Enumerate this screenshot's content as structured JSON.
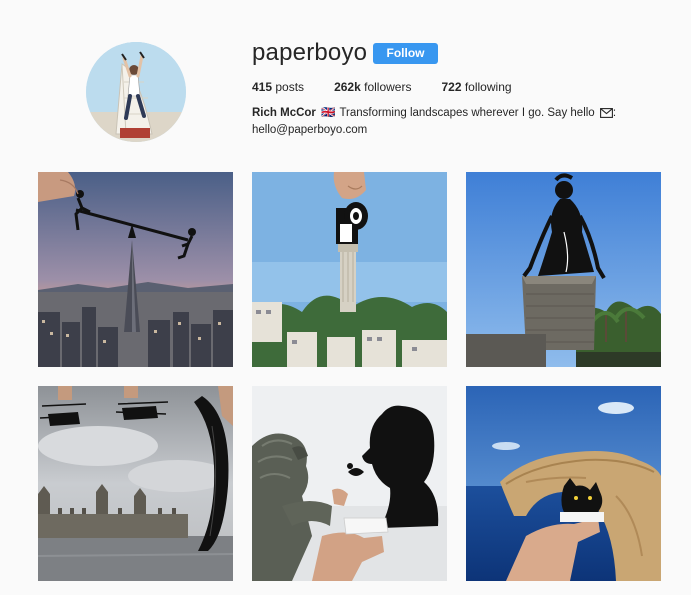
{
  "profile": {
    "username": "paperboyo",
    "follow_label": "Follow",
    "accent_color": "#3897f0",
    "stats": [
      {
        "count": "415",
        "label": "posts"
      },
      {
        "count": "262k",
        "label": "followers"
      },
      {
        "count": "722",
        "label": "following"
      }
    ],
    "bio": {
      "name": "Rich McCor",
      "flag": "🇬🇧",
      "text": "Transforming landscapes wherever I go. Say hello",
      "email": "hello@paperboyo.com",
      "envelope_icon": "envelope-icon"
    }
  },
  "posts": [
    {
      "subject": "paper seesaw over city skyline"
    },
    {
      "subject": "paper toilet roll over tower"
    },
    {
      "subject": "paper figure over building"
    },
    {
      "subject": "paper helicopters over parliament"
    },
    {
      "subject": "paper silhouette with lion statue"
    },
    {
      "subject": "paper cat in rock arch"
    }
  ]
}
